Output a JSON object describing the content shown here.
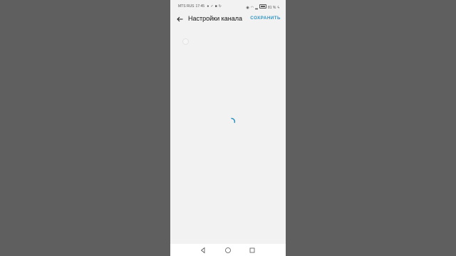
{
  "status_bar": {
    "carrier": "MTS RUS",
    "time": "17:45",
    "notif_icons": [
      "message-icon",
      "check-icon",
      "youtube-icon",
      "sync-icon"
    ],
    "right_icons": [
      "eye-icon",
      "wifi-icon",
      "signal-icon"
    ],
    "battery": "81 %",
    "battery_percent": 81
  },
  "app_bar": {
    "title": "Настройки канала",
    "save_label": "СОХРАНИТЬ",
    "back_icon": "arrow-left-icon"
  },
  "colors": {
    "accent": "#2f92c2",
    "background": "#f2f2f2",
    "outside": "#5f5f5f"
  },
  "nav_bar": {
    "icons": [
      "triangle-back-icon",
      "circle-home-icon",
      "square-recent-icon"
    ]
  }
}
